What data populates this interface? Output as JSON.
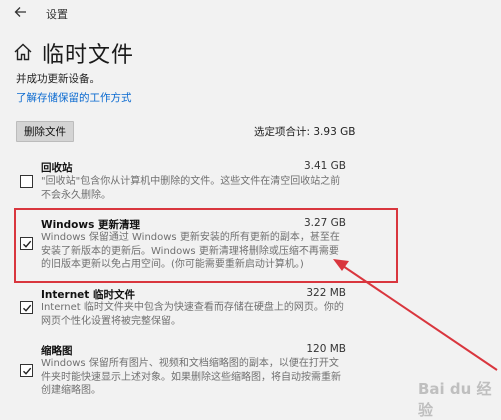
{
  "window": {
    "title": "设置"
  },
  "page": {
    "title": "临时文件",
    "subtitle": "并成功更新设备。",
    "learn_link": "了解存储保留的工作方式"
  },
  "actions": {
    "delete_label": "删除文件",
    "total_selected": "选定项合计: 3.93 GB"
  },
  "items": [
    {
      "name": "回收站",
      "size": "3.41 GB",
      "checked": false,
      "desc": "\"回收站\"包含你从计算机中删除的文件。这些文件在清空回收站之前不会永久删除。"
    },
    {
      "name": "Windows 更新清理",
      "size": "3.27 GB",
      "checked": true,
      "desc": "Windows 保留通过 Windows 更新安装的所有更新的副本，甚至在安装了新版本的更新后。Windows 更新清理将删除或压缩不再需要的旧版本更新以免占用空间。(你可能需要重新启动计算机。)"
    },
    {
      "name": "Internet 临时文件",
      "size": "322 MB",
      "checked": true,
      "desc": "Internet 临时文件夹中包含为快速查看而存储在硬盘上的网页。你的网页个性化设置将被完整保留。"
    },
    {
      "name": "缩略图",
      "size": "120 MB",
      "checked": true,
      "desc": "Windows 保留所有图片、视频和文档缩略图的副本，以便在打开文件夹时能快速显示上述对象。如果删除这些缩略图，将自动按需重新创建缩略图。"
    }
  ],
  "watermark": "Bai du 经验",
  "colors": {
    "link": "#0b6ad0",
    "annotation": "#d9363e"
  },
  "icons": {
    "back": "back-arrow-icon",
    "home": "home-icon",
    "check": "checkmark-icon"
  }
}
